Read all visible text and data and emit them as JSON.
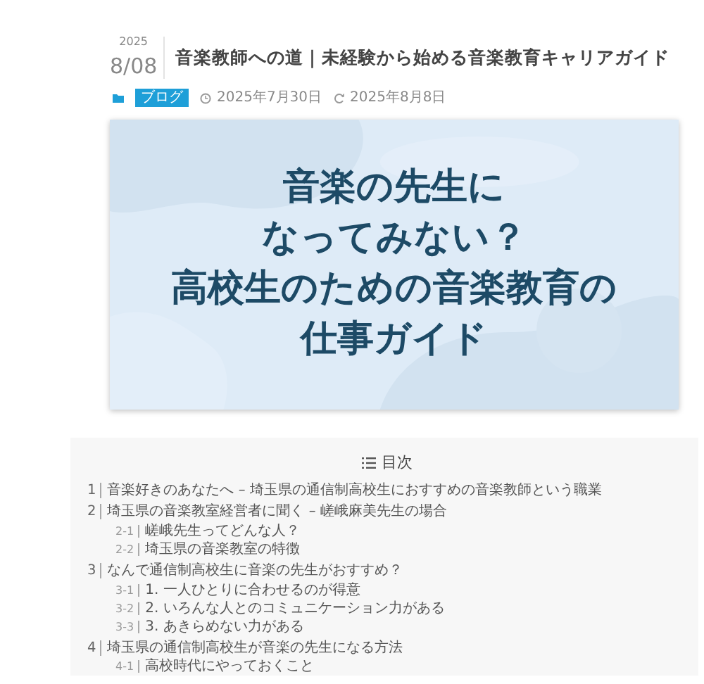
{
  "post": {
    "date_year": "2025",
    "date_day": "8/08",
    "title": "音楽教師への道｜未経験から始める音楽教育キャリアガイド",
    "category": "ブログ",
    "published": "2025年7月30日",
    "updated": "2025年8月8日"
  },
  "hero": {
    "kind": "picture",
    "lines": [
      "音楽の先生に",
      "なってみない？",
      "高校生のための音楽教育の",
      "仕事ガイド"
    ]
  },
  "toc": {
    "title": "目次",
    "items": [
      {
        "number": "1",
        "text": "音楽好きのあなたへ – 埼玉県の通信制高校生におすすめの音楽教師という職業"
      },
      {
        "number": "2",
        "text": "埼玉県の音楽教室経営者に聞く – 嵯峨麻美先生の場合",
        "children": [
          {
            "number": "2-1",
            "text": "嵯峨先生ってどんな人？"
          },
          {
            "number": "2-2",
            "text": "埼玉県の音楽教室の特徴"
          }
        ]
      },
      {
        "number": "3",
        "text": "なんで通信制高校生に音楽の先生がおすすめ？",
        "children": [
          {
            "number": "3-1",
            "text": "1. 一人ひとりに合わせるのが得意"
          },
          {
            "number": "3-2",
            "text": "2. いろんな人とのコミュニケーション力がある"
          },
          {
            "number": "3-3",
            "text": "3. あきらめない力がある"
          }
        ]
      },
      {
        "number": "4",
        "text": "埼玉県の通信制高校生が音楽の先生になる方法",
        "children": [
          {
            "number": "4-1",
            "text": "高校時代にやっておくこと"
          }
        ]
      }
    ]
  }
}
